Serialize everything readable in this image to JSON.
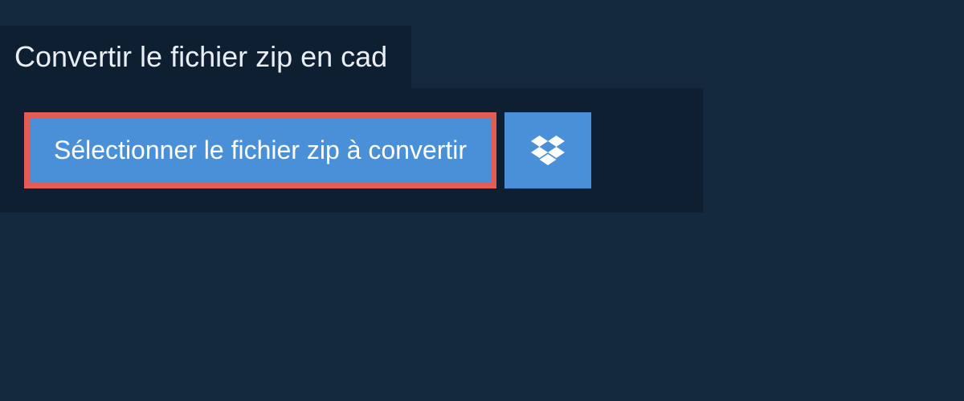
{
  "tab": {
    "title": "Convertir le fichier zip en cad"
  },
  "buttons": {
    "select_label": "Sélectionner le fichier zip à convertir"
  }
}
